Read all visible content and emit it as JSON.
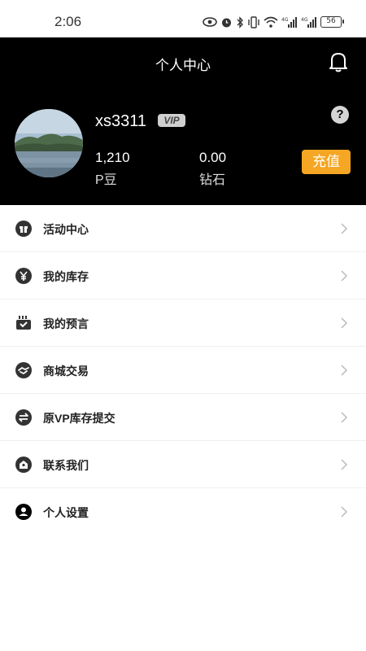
{
  "status_bar": {
    "time": "2:06",
    "battery": "56"
  },
  "header": {
    "title": "个人中心"
  },
  "profile": {
    "username": "xs3311",
    "vip_badge": "VIP",
    "help_icon": "?",
    "beans_value": "1,210",
    "beans_label": "P豆",
    "diamonds_value": "0.00",
    "diamonds_label": "钻石",
    "recharge_label": "充值"
  },
  "menu": {
    "items": [
      {
        "label": "活动中心",
        "icon": "gift-icon"
      },
      {
        "label": "我的库存",
        "icon": "yen-icon"
      },
      {
        "label": "我的预言",
        "icon": "prediction-icon"
      },
      {
        "label": "商城交易",
        "icon": "handshake-icon"
      },
      {
        "label": "原VP库存提交",
        "icon": "exchange-icon"
      },
      {
        "label": "联系我们",
        "icon": "contact-icon"
      },
      {
        "label": "个人设置",
        "icon": "user-icon"
      }
    ]
  },
  "colors": {
    "header_bg": "#000000",
    "accent": "#f5a623"
  }
}
